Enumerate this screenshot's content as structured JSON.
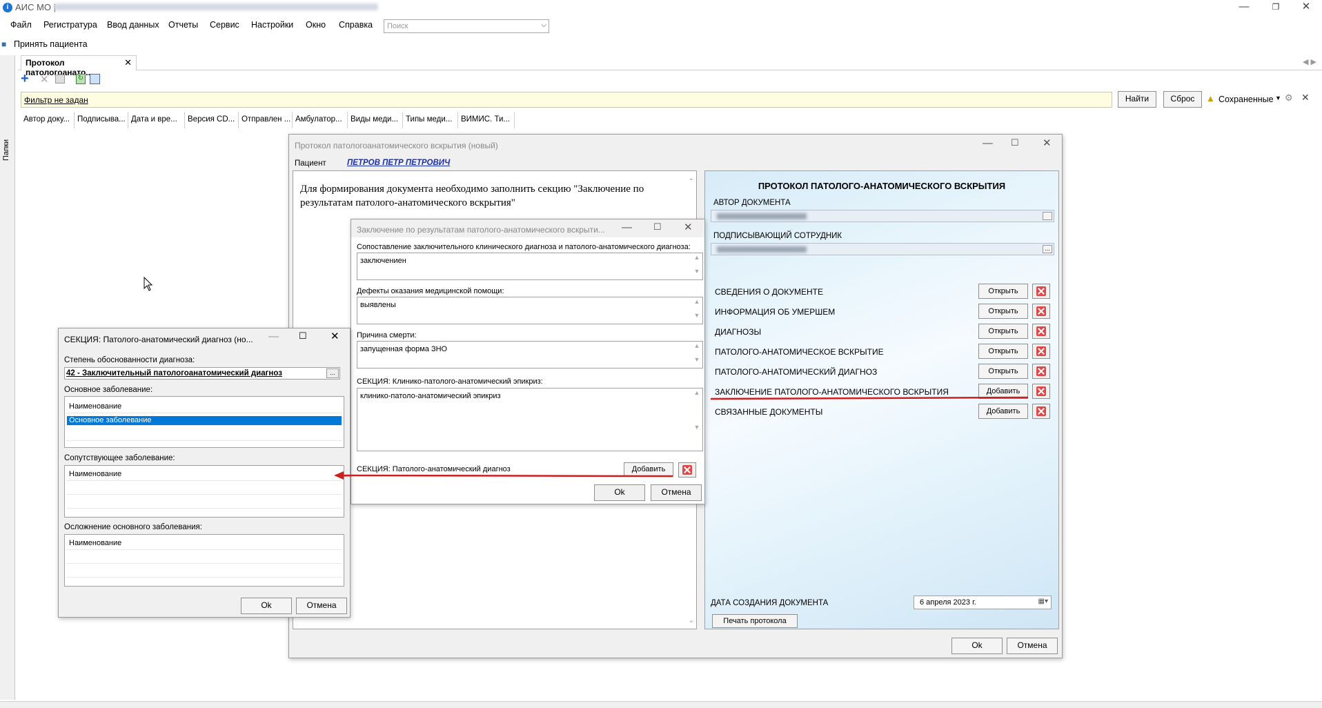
{
  "window": {
    "title": "АИС МО |"
  },
  "menu": [
    "Файл",
    "Регистратура",
    "Ввод данных",
    "Отчеты",
    "Сервис",
    "Настройки",
    "Окно",
    "Справка"
  ],
  "search": {
    "placeholder": "Поиск"
  },
  "toolbar": {
    "accept_patient": "Принять пациента"
  },
  "leftstrip": {
    "label": "Папки"
  },
  "tab": {
    "label": "Протокол патологоанато..."
  },
  "filter": {
    "text": "Фильтр не задан",
    "find": "Найти",
    "reset": "Сброс",
    "saved": "Сохраненные"
  },
  "grid_columns": [
    "Автор доку...",
    "Подписыва...",
    "Дата и вре...",
    "Версия CD...",
    "Отправлен ...",
    "Амбулатор...",
    "Виды меди...",
    "Типы меди...",
    "ВИМИС. Ти..."
  ],
  "protocol_window": {
    "title": "Протокол патологоанатомического вскрытия (новый)",
    "patient_label": "Пациент",
    "patient_name": "ПЕТРОВ ПЕТР ПЕТРОВИЧ",
    "notice": "Для формирования документа необходимо заполнить секцию \"Заключение по результатам патолого-анатомического вскрытия\"",
    "heading": "ПРОТОКОЛ ПАТОЛОГО-АНАТОМИЧЕСКОГО ВСКРЫТИЯ",
    "author_label": "АВТОР ДОКУМЕНТА",
    "signer_label": "ПОДПИСЫВАЮЩИЙ СОТРУДНИК",
    "sections": [
      {
        "label": "СВЕДЕНИЯ О ДОКУМЕНТЕ",
        "button": "Открыть"
      },
      {
        "label": "ИНФОРМАЦИЯ ОБ УМЕРШЕМ",
        "button": "Открыть"
      },
      {
        "label": "ДИАГНОЗЫ",
        "button": "Открыть"
      },
      {
        "label": "ПАТОЛОГО-АНАТОМИЧЕСКОЕ ВСКРЫТИЕ",
        "button": "Открыть"
      },
      {
        "label": "ПАТОЛОГО-АНАТОМИЧЕСКИЙ ДИАГНОЗ",
        "button": "Открыть"
      },
      {
        "label": "ЗАКЛЮЧЕНИЕ ПАТОЛОГО-АНАТОМИЧЕСКОГО ВСКРЫТИЯ",
        "button": "Добавить"
      },
      {
        "label": "СВЯЗАННЫЕ ДОКУМЕНТЫ",
        "button": "Добавить"
      }
    ],
    "date_label": "ДАТА СОЗДАНИЯ ДОКУМЕНТА",
    "date_value": "6  апреля   2023 г.",
    "print_button": "Печать протокола",
    "ok": "Ok",
    "cancel": "Отмена"
  },
  "conclusion_window": {
    "title": "Заключение по результатам патолого-анатомического вскрыти...",
    "field1_label": "Сопоставление заключительного клинического диагноза и патолого-анатомического диагноза:",
    "field1_value": "заключениен",
    "field2_label": "Дефекты оказания медицинской помощи:",
    "field2_value": "выявлены",
    "field3_label": "Причина смерти:",
    "field3_value": "запущенная форма ЗНО",
    "field4_label": "СЕКЦИЯ: Клинико-патолого-анатомический эпикриз:",
    "field4_value": "клинико-патоло-анатомический эпикриз",
    "section_label": "СЕКЦИЯ: Патолого-анатомический диагноз",
    "add_button": "Добавить",
    "ok": "Ok",
    "cancel": "Отмена"
  },
  "diagnosis_window": {
    "title": "СЕКЦИЯ: Патолого-анатомический диагноз (но...",
    "degree_label": "Степень обоснованности диагноза:",
    "degree_value": "42 - Заключительный патологоанатомический диагноз",
    "main_label": "Основное заболевание:",
    "main_header": "Наименование",
    "main_row": "Основное заболевание",
    "concomitant_label": "Сопутствующее заболевание:",
    "concomitant_header": "Наименование",
    "complication_label": "Осложнение основного заболевания:",
    "complication_header": "Наименование",
    "ok": "Ok",
    "cancel": "Отмена"
  },
  "colors": {
    "accent": "#0078d7",
    "arrow": "#cc1f1f",
    "filter_bg": "#fffde1"
  }
}
